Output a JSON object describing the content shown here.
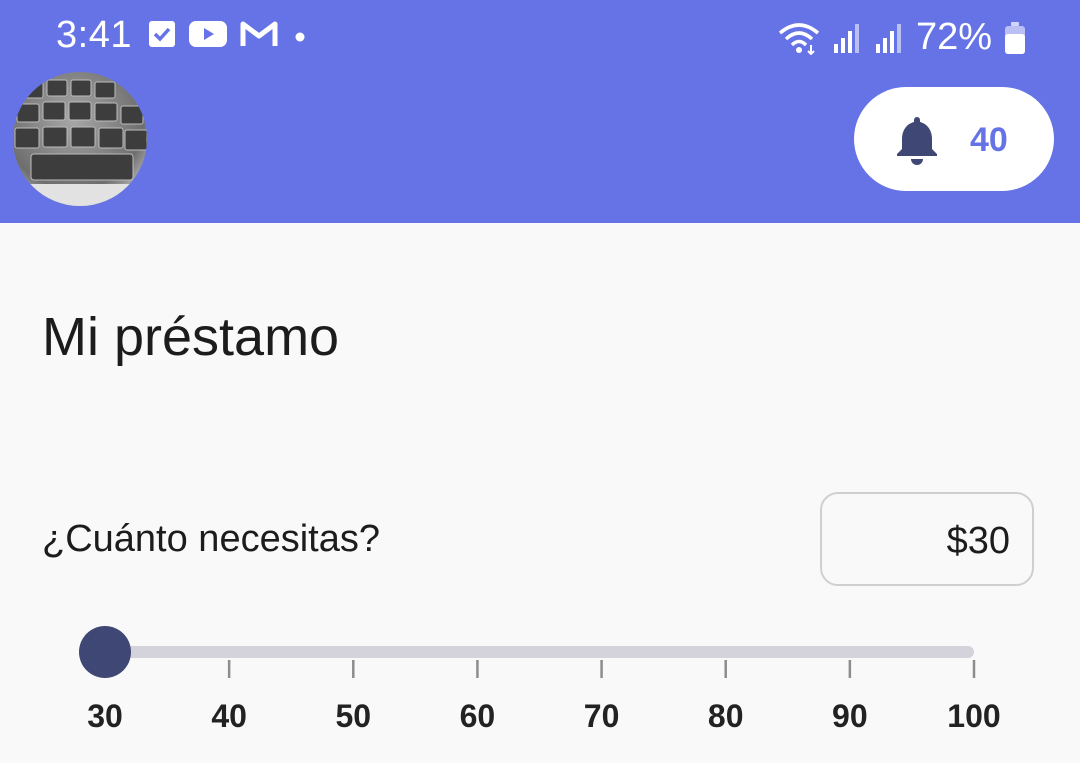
{
  "status_bar": {
    "time": "3:41",
    "battery": "72%",
    "left_icons": [
      "check-square-icon",
      "youtube-icon",
      "gmail-icon",
      "dot-icon"
    ],
    "right_icons": [
      "wifi-icon",
      "signal-icon",
      "signal-icon",
      "battery-icon"
    ]
  },
  "header": {
    "notification_count": "40"
  },
  "main": {
    "title": "Mi préstamo",
    "question": "¿Cuánto necesitas?",
    "amount": "$30"
  },
  "slider": {
    "value": 30,
    "min": 30,
    "max": 100,
    "ticks": [
      "30",
      "40",
      "50",
      "60",
      "70",
      "80",
      "90",
      "100"
    ]
  },
  "colors": {
    "primary": "#6673e6",
    "thumb": "#3f4875",
    "track": "#d4d2da",
    "background": "#f9f9f9"
  }
}
